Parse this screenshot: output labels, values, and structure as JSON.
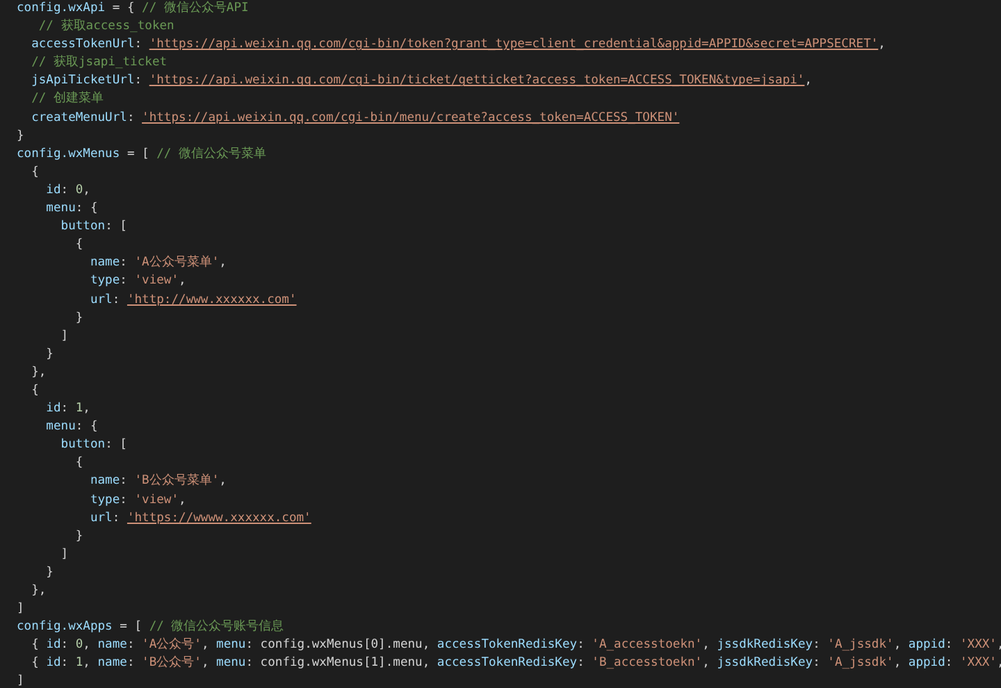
{
  "editor": {
    "lines": [
      [
        {
          "kind": "var",
          "text": "config.wxApi"
        },
        {
          "kind": "punct",
          "text": " = { "
        },
        {
          "kind": "comment",
          "text": "// 微信公众号API"
        }
      ],
      [
        {
          "kind": "comment",
          "text": "   // 获取access_token"
        }
      ],
      [
        {
          "kind": "var",
          "text": "  accessTokenUrl"
        },
        {
          "kind": "punct",
          "text": ": "
        },
        {
          "kind": "url",
          "text": "'https://api.weixin.qq.com/cgi-bin/token?grant_type=client_credential&appid=APPID&secret=APPSECRET'"
        },
        {
          "kind": "punct",
          "text": ","
        }
      ],
      [
        {
          "kind": "comment",
          "text": "  // 获取jsapi_ticket"
        }
      ],
      [
        {
          "kind": "var",
          "text": "  jsApiTicketUrl"
        },
        {
          "kind": "punct",
          "text": ": "
        },
        {
          "kind": "url",
          "text": "'https://api.weixin.qq.com/cgi-bin/ticket/getticket?access_token=ACCESS_TOKEN&type=jsapi'"
        },
        {
          "kind": "punct",
          "text": ","
        }
      ],
      [
        {
          "kind": "comment",
          "text": "  // 创建菜单"
        }
      ],
      [
        {
          "kind": "var",
          "text": "  createMenuUrl"
        },
        {
          "kind": "punct",
          "text": ": "
        },
        {
          "kind": "url",
          "text": "'https://api.weixin.qq.com/cgi-bin/menu/create?access_token=ACCESS_TOKEN'"
        }
      ],
      [
        {
          "kind": "punct",
          "text": "}"
        }
      ],
      [
        {
          "kind": "var",
          "text": "config.wxMenus"
        },
        {
          "kind": "punct",
          "text": " = [ "
        },
        {
          "kind": "comment",
          "text": "// 微信公众号菜单"
        }
      ],
      [
        {
          "kind": "punct",
          "text": "  {"
        }
      ],
      [
        {
          "kind": "var",
          "text": "    id"
        },
        {
          "kind": "punct",
          "text": ": "
        },
        {
          "kind": "number",
          "text": "0"
        },
        {
          "kind": "punct",
          "text": ","
        }
      ],
      [
        {
          "kind": "var",
          "text": "    menu"
        },
        {
          "kind": "punct",
          "text": ": {"
        }
      ],
      [
        {
          "kind": "var",
          "text": "      button"
        },
        {
          "kind": "punct",
          "text": ": ["
        }
      ],
      [
        {
          "kind": "punct",
          "text": "        {"
        }
      ],
      [
        {
          "kind": "var",
          "text": "          name"
        },
        {
          "kind": "punct",
          "text": ": "
        },
        {
          "kind": "string",
          "text": "'A公众号菜单'"
        },
        {
          "kind": "punct",
          "text": ","
        }
      ],
      [
        {
          "kind": "var",
          "text": "          type"
        },
        {
          "kind": "punct",
          "text": ": "
        },
        {
          "kind": "string",
          "text": "'view'"
        },
        {
          "kind": "punct",
          "text": ","
        }
      ],
      [
        {
          "kind": "var",
          "text": "          url"
        },
        {
          "kind": "punct",
          "text": ": "
        },
        {
          "kind": "url",
          "text": "'http://www.xxxxxx.com'"
        }
      ],
      [
        {
          "kind": "punct",
          "text": "        }"
        }
      ],
      [
        {
          "kind": "punct",
          "text": "      ]"
        }
      ],
      [
        {
          "kind": "punct",
          "text": "    }"
        }
      ],
      [
        {
          "kind": "punct",
          "text": "  },"
        }
      ],
      [
        {
          "kind": "punct",
          "text": "  {"
        }
      ],
      [
        {
          "kind": "var",
          "text": "    id"
        },
        {
          "kind": "punct",
          "text": ": "
        },
        {
          "kind": "number",
          "text": "1"
        },
        {
          "kind": "punct",
          "text": ","
        }
      ],
      [
        {
          "kind": "var",
          "text": "    menu"
        },
        {
          "kind": "punct",
          "text": ": {"
        }
      ],
      [
        {
          "kind": "var",
          "text": "      button"
        },
        {
          "kind": "punct",
          "text": ": ["
        }
      ],
      [
        {
          "kind": "punct",
          "text": "        {"
        }
      ],
      [
        {
          "kind": "var",
          "text": "          name"
        },
        {
          "kind": "punct",
          "text": ": "
        },
        {
          "kind": "string",
          "text": "'B公众号菜单'"
        },
        {
          "kind": "punct",
          "text": ","
        }
      ],
      [
        {
          "kind": "var",
          "text": "          type"
        },
        {
          "kind": "punct",
          "text": ": "
        },
        {
          "kind": "string",
          "text": "'view'"
        },
        {
          "kind": "punct",
          "text": ","
        }
      ],
      [
        {
          "kind": "var",
          "text": "          url"
        },
        {
          "kind": "punct",
          "text": ": "
        },
        {
          "kind": "url",
          "text": "'https://wwww.xxxxxx.com'"
        }
      ],
      [
        {
          "kind": "punct",
          "text": "        }"
        }
      ],
      [
        {
          "kind": "punct",
          "text": "      ]"
        }
      ],
      [
        {
          "kind": "punct",
          "text": "    }"
        }
      ],
      [
        {
          "kind": "punct",
          "text": "  },"
        }
      ],
      [
        {
          "kind": "punct",
          "text": "]"
        }
      ],
      [
        {
          "kind": "var",
          "text": "config.wxApps"
        },
        {
          "kind": "punct",
          "text": " = [ "
        },
        {
          "kind": "comment",
          "text": "// 微信公众号账号信息"
        }
      ],
      [
        {
          "kind": "punct",
          "text": "  { "
        },
        {
          "kind": "var",
          "text": "id"
        },
        {
          "kind": "punct",
          "text": ": "
        },
        {
          "kind": "number",
          "text": "0"
        },
        {
          "kind": "punct",
          "text": ", "
        },
        {
          "kind": "var",
          "text": "name"
        },
        {
          "kind": "punct",
          "text": ": "
        },
        {
          "kind": "string",
          "text": "'A公众号'"
        },
        {
          "kind": "punct",
          "text": ", "
        },
        {
          "kind": "var",
          "text": "menu"
        },
        {
          "kind": "punct",
          "text": ": config.wxMenus[0].menu, "
        },
        {
          "kind": "var",
          "text": "accessTokenRedisKey"
        },
        {
          "kind": "punct",
          "text": ": "
        },
        {
          "kind": "string",
          "text": "'A_accesstoekn'"
        },
        {
          "kind": "punct",
          "text": ", "
        },
        {
          "kind": "var",
          "text": "jssdkRedisKey"
        },
        {
          "kind": "punct",
          "text": ": "
        },
        {
          "kind": "string",
          "text": "'A_jssdk'"
        },
        {
          "kind": "punct",
          "text": ", "
        },
        {
          "kind": "var",
          "text": "appid"
        },
        {
          "kind": "punct",
          "text": ": "
        },
        {
          "kind": "string",
          "text": "'XXX'"
        },
        {
          "kind": "punct",
          "text": ","
        }
      ],
      [
        {
          "kind": "punct",
          "text": "  { "
        },
        {
          "kind": "var",
          "text": "id"
        },
        {
          "kind": "punct",
          "text": ": "
        },
        {
          "kind": "number",
          "text": "1"
        },
        {
          "kind": "punct",
          "text": ", "
        },
        {
          "kind": "var",
          "text": "name"
        },
        {
          "kind": "punct",
          "text": ": "
        },
        {
          "kind": "string",
          "text": "'B公众号'"
        },
        {
          "kind": "punct",
          "text": ", "
        },
        {
          "kind": "var",
          "text": "menu"
        },
        {
          "kind": "punct",
          "text": ": config.wxMenus[1].menu, "
        },
        {
          "kind": "var",
          "text": "accessTokenRedisKey"
        },
        {
          "kind": "punct",
          "text": ": "
        },
        {
          "kind": "string",
          "text": "'B_accesstoekn'"
        },
        {
          "kind": "punct",
          "text": ", "
        },
        {
          "kind": "var",
          "text": "jssdkRedisKey"
        },
        {
          "kind": "punct",
          "text": ": "
        },
        {
          "kind": "string",
          "text": "'A_jssdk'"
        },
        {
          "kind": "punct",
          "text": ", "
        },
        {
          "kind": "var",
          "text": "appid"
        },
        {
          "kind": "punct",
          "text": ": "
        },
        {
          "kind": "string",
          "text": "'XXX'"
        },
        {
          "kind": "punct",
          "text": ","
        }
      ],
      [
        {
          "kind": "punct",
          "text": "]"
        }
      ]
    ]
  }
}
